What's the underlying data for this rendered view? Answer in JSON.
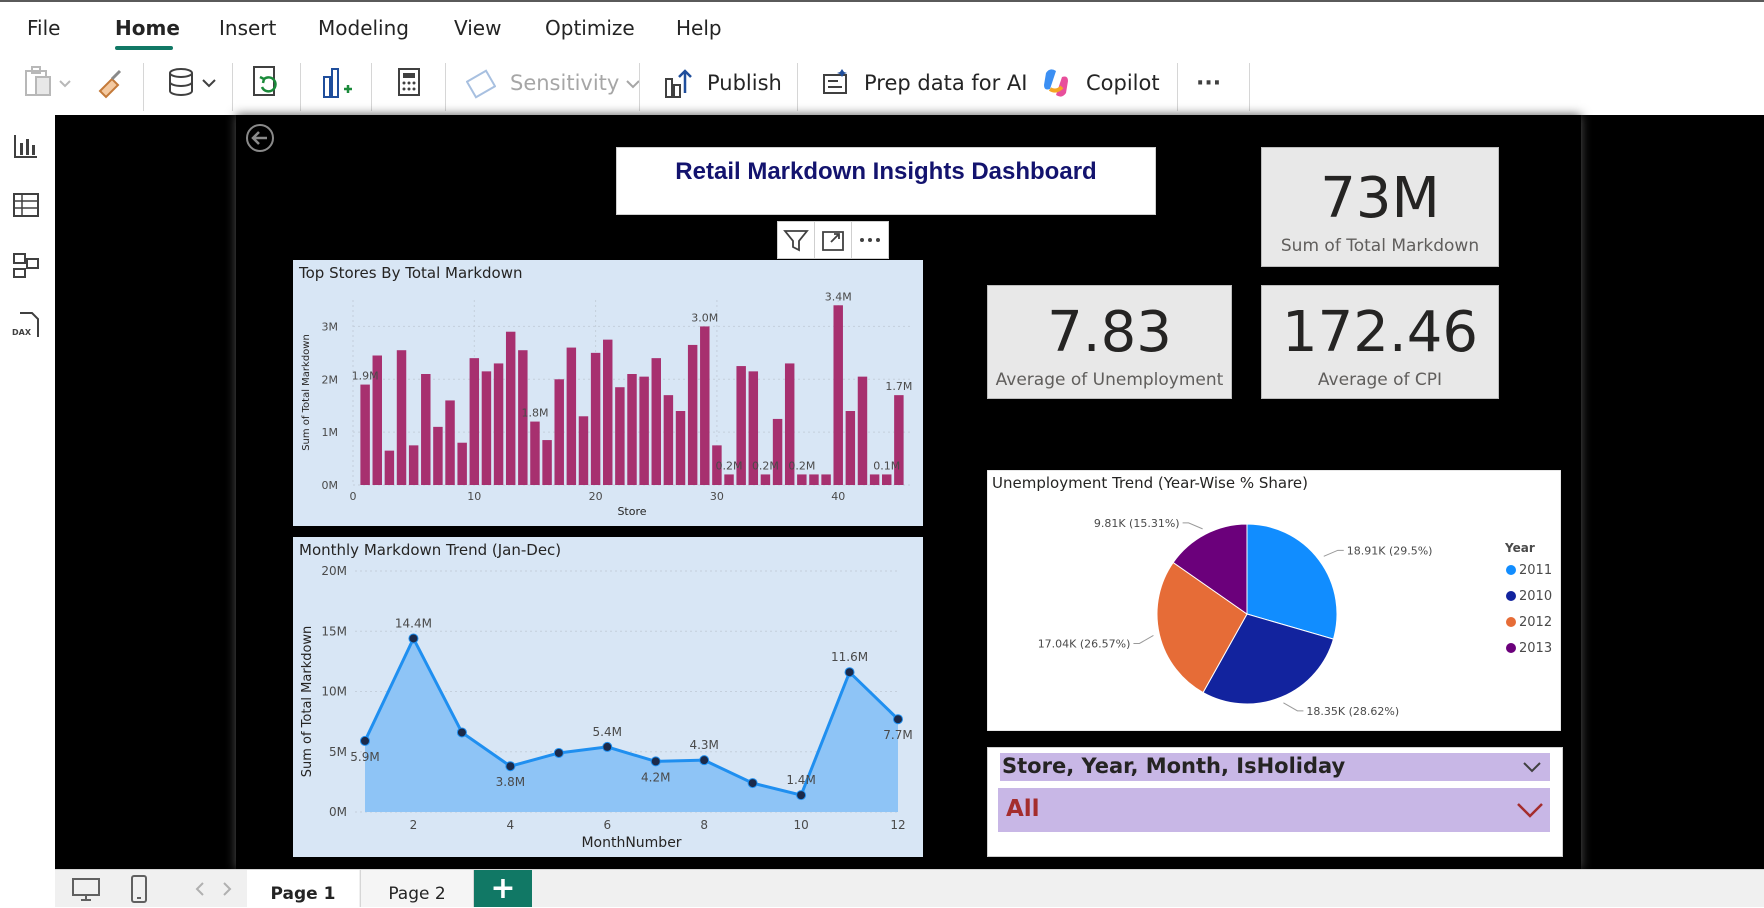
{
  "menu": {
    "items": [
      {
        "label": "File"
      },
      {
        "label": "Home"
      },
      {
        "label": "Insert"
      },
      {
        "label": "Modeling"
      },
      {
        "label": "View"
      },
      {
        "label": "Optimize"
      },
      {
        "label": "Help"
      }
    ],
    "active": "Home"
  },
  "ribbon": {
    "sensitivity_label": "Sensitivity",
    "publish_label": "Publish",
    "prep_data_label": "Prep data for AI",
    "copilot_label": "Copilot",
    "more_label": "···"
  },
  "report": {
    "title": "Retail Markdown Insights Dashboard",
    "cards": [
      {
        "value": "73M",
        "label": "Sum of Total Markdown"
      },
      {
        "value": "7.83",
        "label": "Average of Unemployment"
      },
      {
        "value": "172.46",
        "label": "Average of CPI"
      }
    ],
    "slicer": {
      "header": "Store, Year, Month, IsHoliday",
      "selected": "All"
    }
  },
  "chart_data": [
    {
      "type": "bar",
      "title": "Top Stores By Total Markdown",
      "xlabel": "Store",
      "ylabel": "Sum of Total Markdown",
      "x_ticks": [
        "0",
        "10",
        "20",
        "30",
        "40"
      ],
      "y_ticks": [
        "0M",
        "1M",
        "2M",
        "3M"
      ],
      "ylim": [
        0,
        3.5
      ],
      "color": "#a7306f",
      "categories": [
        1,
        2,
        3,
        4,
        5,
        6,
        7,
        8,
        9,
        10,
        11,
        12,
        13,
        14,
        15,
        16,
        17,
        18,
        19,
        20,
        21,
        22,
        23,
        24,
        25,
        26,
        27,
        28,
        29,
        30,
        31,
        32,
        33,
        34,
        35,
        36,
        37,
        38,
        39,
        40,
        41,
        42,
        43,
        44,
        45
      ],
      "values": [
        1.9,
        2.45,
        0.65,
        2.55,
        0.75,
        2.1,
        1.1,
        1.6,
        0.8,
        2.4,
        2.15,
        2.3,
        2.9,
        2.55,
        1.2,
        0.85,
        2.0,
        2.6,
        1.3,
        2.5,
        2.75,
        1.85,
        2.1,
        2.05,
        2.4,
        1.7,
        1.4,
        2.65,
        3.0,
        0.75,
        0.2,
        2.25,
        2.15,
        0.2,
        1.25,
        2.3,
        0.2,
        0.2,
        0.2,
        3.4,
        1.4,
        2.05,
        0.2,
        0.2,
        1.7
      ],
      "data_labels": [
        {
          "store": 1,
          "text": "1.9M"
        },
        {
          "store": 15,
          "text": "1.8M"
        },
        {
          "store": 29,
          "text": "3.0M"
        },
        {
          "store": 31,
          "text": "0.2M"
        },
        {
          "store": 34,
          "text": "0.2M"
        },
        {
          "store": 37,
          "text": "0.2M"
        },
        {
          "store": 40,
          "text": "3.4M"
        },
        {
          "store": 44,
          "text": "0.1M"
        },
        {
          "store": 45,
          "text": "1.7M"
        }
      ],
      "background": "#d8e6f5"
    },
    {
      "type": "area",
      "title": "Monthly Markdown Trend (Jan-Dec)",
      "xlabel": "MonthNumber",
      "ylabel": "Sum of Total Markdown",
      "x_ticks": [
        "2",
        "4",
        "6",
        "8",
        "10",
        "12"
      ],
      "y_ticks": [
        "0M",
        "5M",
        "10M",
        "15M",
        "20M"
      ],
      "ylim": [
        0,
        20
      ],
      "x": [
        1,
        2,
        3,
        4,
        5,
        6,
        7,
        8,
        9,
        10,
        11,
        12
      ],
      "values": [
        5.9,
        14.4,
        6.6,
        3.8,
        4.9,
        5.4,
        4.2,
        4.3,
        2.4,
        1.4,
        11.6,
        7.7
      ],
      "data_labels": [
        {
          "month": 1,
          "text": "5.9M",
          "pos": "below"
        },
        {
          "month": 2,
          "text": "14.4M",
          "pos": "above"
        },
        {
          "month": 4,
          "text": "3.8M",
          "pos": "below"
        },
        {
          "month": 6,
          "text": "5.4M",
          "pos": "above"
        },
        {
          "month": 7,
          "text": "4.2M",
          "pos": "below"
        },
        {
          "month": 8,
          "text": "4.3M",
          "pos": "above"
        },
        {
          "month": 10,
          "text": "1.4M",
          "pos": "above"
        },
        {
          "month": 11,
          "text": "11.6M",
          "pos": "above"
        },
        {
          "month": 12,
          "text": "7.7M",
          "pos": "below"
        }
      ],
      "line_color": "#1f8ff0",
      "fill_color": "#8ec4f6",
      "background": "#d8e6f5"
    },
    {
      "type": "pie",
      "title": "Unemployment Trend (Year-Wise % Share)",
      "legend_title": "Year",
      "legend_position": "right",
      "slices": [
        {
          "name": "2011",
          "value": 18.91,
          "label": "18.91K (29.5%)",
          "color": "#118dff"
        },
        {
          "name": "2010",
          "value": 18.35,
          "label": "18.35K (28.62%)",
          "color": "#12239e"
        },
        {
          "name": "2012",
          "value": 17.04,
          "label": "17.04K (26.57%)",
          "color": "#e66c37"
        },
        {
          "name": "2013",
          "value": 9.81,
          "label": "9.81K (15.31%)",
          "color": "#6b007b"
        }
      ]
    }
  ]
}
